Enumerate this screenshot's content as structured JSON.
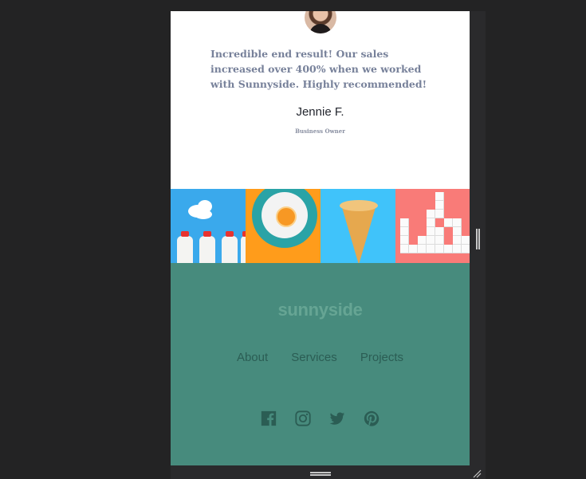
{
  "testimonial": {
    "quote": "Incredible end result! Our sales increased over 400% when we worked with Sunnyside. Highly recommended!",
    "name": "Jennie F.",
    "role": "Business Owner"
  },
  "gallery": {
    "images": [
      "milk-bottles-image",
      "orange-plate-image",
      "ice-cream-cone-image",
      "sugar-cubes-image"
    ]
  },
  "footer": {
    "logo": "sunnyside",
    "nav": [
      "About",
      "Services",
      "Projects"
    ],
    "social_icons": [
      "facebook-icon",
      "instagram-icon",
      "twitter-icon",
      "pinterest-icon"
    ]
  },
  "colors": {
    "footer_bg": "#478b7d",
    "nav_text": "#2b5d54",
    "logo_text": "#66a594"
  }
}
